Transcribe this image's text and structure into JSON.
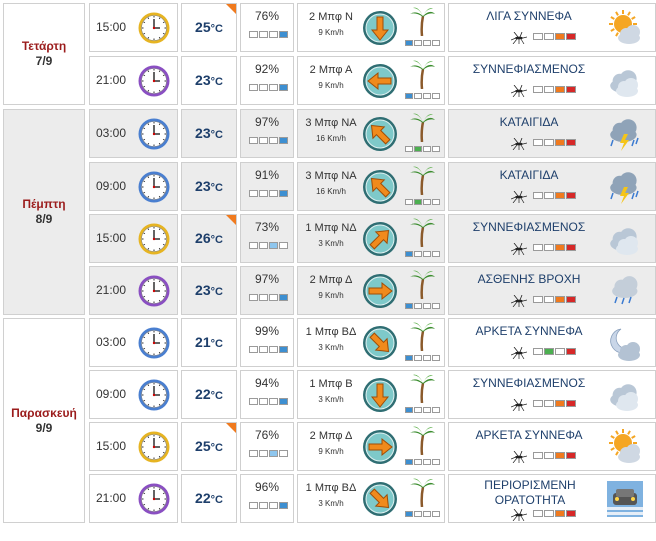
{
  "units": {
    "temp": "°C"
  },
  "days": [
    {
      "name": "Τετάρτη",
      "date": "7/9",
      "shaded": false
    },
    {
      "name": "Πέμπτη",
      "date": "8/9",
      "shaded": true
    },
    {
      "name": "Παρασκευή",
      "date": "9/9",
      "shaded": false
    }
  ],
  "rows": [
    {
      "day": 0,
      "time": "15:00",
      "clock": "yellow-clock-icon",
      "temp": "25",
      "warm": true,
      "humidity": "76%",
      "hum_level": 4,
      "wind_speed": "2 Μπφ Ν",
      "wind_kmh": "9 Km/h",
      "wind_dir": "N",
      "wind_level": 1,
      "condition": "ΛΙΓΑ ΣΥΝΝΕΦΑ",
      "mosquito": 3,
      "icon": "sun-few-clouds-icon"
    },
    {
      "day": 0,
      "time": "21:00",
      "clock": "purple-clock-icon",
      "temp": "23",
      "warm": false,
      "humidity": "92%",
      "hum_level": 4,
      "wind_speed": "2 Μπφ Α",
      "wind_kmh": "9 Km/h",
      "wind_dir": "E",
      "wind_level": 1,
      "condition": "ΣΥΝΝΕΦΙΑΣΜΕΝΟΣ",
      "mosquito": 3,
      "icon": "cloudy-icon"
    },
    {
      "day": 1,
      "time": "03:00",
      "clock": "blue-clock-icon",
      "temp": "23",
      "warm": false,
      "humidity": "97%",
      "hum_level": 4,
      "wind_speed": "3 Μπφ ΝΑ",
      "wind_kmh": "16 Km/h",
      "wind_dir": "SE",
      "wind_level": 2,
      "condition": "ΚΑΤΑΙΓΙΔΑ",
      "mosquito": 3,
      "icon": "thunderstorm-icon"
    },
    {
      "day": 1,
      "time": "09:00",
      "clock": "blue-clock-icon",
      "temp": "23",
      "warm": false,
      "humidity": "91%",
      "hum_level": 4,
      "wind_speed": "3 Μπφ ΝΑ",
      "wind_kmh": "16 Km/h",
      "wind_dir": "SE",
      "wind_level": 2,
      "condition": "ΚΑΤΑΙΓΙΔΑ",
      "mosquito": 3,
      "icon": "thunderstorm-icon"
    },
    {
      "day": 1,
      "time": "15:00",
      "clock": "yellow-clock-icon",
      "temp": "26",
      "warm": true,
      "humidity": "73%",
      "hum_level": 3,
      "wind_speed": "1 Μπφ ΝΔ",
      "wind_kmh": "3 Km/h",
      "wind_dir": "SW",
      "wind_level": 1,
      "condition": "ΣΥΝΝΕΦΙΑΣΜΕΝΟΣ",
      "mosquito": 3,
      "icon": "cloudy-icon"
    },
    {
      "day": 1,
      "time": "21:00",
      "clock": "purple-clock-icon",
      "temp": "23",
      "warm": false,
      "humidity": "97%",
      "hum_level": 4,
      "wind_speed": "2 Μπφ Δ",
      "wind_kmh": "9 Km/h",
      "wind_dir": "W",
      "wind_level": 1,
      "condition": "ΑΣΘΕΝΗΣ ΒΡΟΧΗ",
      "mosquito": 3,
      "icon": "light-rain-icon"
    },
    {
      "day": 2,
      "time": "03:00",
      "clock": "blue-clock-icon",
      "temp": "21",
      "warm": false,
      "humidity": "99%",
      "hum_level": 4,
      "wind_speed": "1 Μπφ ΒΔ",
      "wind_kmh": "3 Km/h",
      "wind_dir": "NW",
      "wind_level": 1,
      "condition": "ΑΡΚΕΤΑ ΣΥΝΝΕΦΑ",
      "mosquito": 2,
      "icon": "moon-clouds-icon"
    },
    {
      "day": 2,
      "time": "09:00",
      "clock": "blue-clock-icon",
      "temp": "22",
      "warm": false,
      "humidity": "94%",
      "hum_level": 4,
      "wind_speed": "1 Μπφ Β",
      "wind_kmh": "3 Km/h",
      "wind_dir": "N",
      "wind_level": 1,
      "condition": "ΣΥΝΝΕΦΙΑΣΜΕΝΟΣ",
      "mosquito": 3,
      "icon": "cloudy-icon"
    },
    {
      "day": 2,
      "time": "15:00",
      "clock": "yellow-clock-icon",
      "temp": "25",
      "warm": true,
      "humidity": "76%",
      "hum_level": 3,
      "wind_speed": "2 Μπφ Δ",
      "wind_kmh": "9 Km/h",
      "wind_dir": "W",
      "wind_level": 1,
      "condition": "ΑΡΚΕΤΑ ΣΥΝΝΕΦΑ",
      "mosquito": 3,
      "icon": "sun-clouds-icon"
    },
    {
      "day": 2,
      "time": "21:00",
      "clock": "purple-clock-icon",
      "temp": "22",
      "warm": false,
      "humidity": "96%",
      "hum_level": 4,
      "wind_speed": "1 Μπφ ΒΔ",
      "wind_kmh": "3 Km/h",
      "wind_dir": "NW",
      "wind_level": 1,
      "condition": "ΠΕΡΙΟΡΙΣΜΕΝΗ ΟΡΑΤΟΤΗΤΑ",
      "mosquito": 3,
      "icon": "limited-visibility-icon"
    }
  ],
  "colors": {
    "humidity_bar": "#3d8fd1",
    "humidity_light": "#8ec6ee",
    "wind_bar": "#4caf50",
    "mosquito_low": "#4caf50",
    "mosquito_mid": "#f07a1e",
    "mosquito_high": "#d62828",
    "warm_corner": "#f07a1e"
  }
}
